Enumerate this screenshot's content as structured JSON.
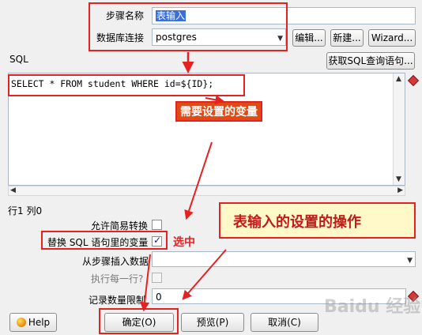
{
  "step": {
    "name_label": "步骤名称",
    "name_value": "表输入"
  },
  "connection": {
    "label": "数据库连接",
    "value": "postgres",
    "edit": "编辑...",
    "new": "新建...",
    "wizard": "Wizard..."
  },
  "sql": {
    "label": "SQL",
    "fetch_button": "获取SQL查询语句...",
    "text": "SELECT * FROM student WHERE id=${ID};"
  },
  "status": {
    "position": "行1 列0"
  },
  "options": {
    "lazy_conversion": "允许简易转换",
    "replace_vars": "替换 SQL 语句里的变量",
    "insert_from_step": "从步骤插入数据",
    "execute_each_row": "执行每一行?",
    "limit_label": "记录数量限制",
    "limit_value": "0"
  },
  "annotations": {
    "variable_note": "需要设置的变量",
    "selected_note": "选中",
    "main_note": "表输入的设置的操作"
  },
  "buttons": {
    "help": "Help",
    "ok": "确定(O)",
    "preview": "预览(P)",
    "cancel": "取消(C)"
  },
  "watermark": "Baidu 经验",
  "colors": {
    "annotation_red": "#e52222",
    "note_bg": "#e04a14",
    "main_note_bg": "#fff8c8",
    "main_note_text": "#c41a1a"
  }
}
